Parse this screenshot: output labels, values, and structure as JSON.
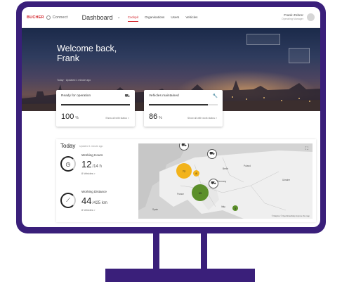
{
  "app": {
    "brand": "BUCHER",
    "brand_sub": "Connect",
    "dashboard_title": "Dashboard"
  },
  "nav": {
    "tabs": [
      "Cockpit",
      "Organisations",
      "Users",
      "Vehicles"
    ],
    "active_tab": 0
  },
  "user": {
    "name": "Frank Zohrer",
    "role": "Operating Manager"
  },
  "hero": {
    "welcome_line1": "Welcome back,",
    "welcome_line2": "Frank",
    "updated": "Today · Updated 1 minute ago"
  },
  "cards": [
    {
      "title": "Ready for operation",
      "icon": "truck-icon",
      "value": "100",
      "unit": "%",
      "progress": 1.0,
      "link": "Show all with status >"
    },
    {
      "title": "Vehicles maintained",
      "icon": "wrench-icon",
      "value": "86",
      "unit": "%",
      "progress": 0.86,
      "link": "Show all with work status >"
    }
  ],
  "today": {
    "title": "Today",
    "updated": "Updated 1 minute ago",
    "metrics": [
      {
        "label": "Working Hours",
        "value": "12",
        "of": "/14 h",
        "vehicles": "8 Vehicles >",
        "icon": "clock-icon"
      },
      {
        "label": "Working Distance",
        "value": "44",
        "of": "/425 km",
        "vehicles": "8 Vehicles >",
        "icon": "road-icon"
      }
    ]
  },
  "map": {
    "labels": [
      "Berlin",
      "Poland",
      "Ukraine",
      "Germany",
      "France",
      "Spain",
      "Italy"
    ],
    "bubbles": [
      {
        "label": "72",
        "color": "#f2b31b"
      },
      {
        "label": "8",
        "color": "#f2b31b"
      },
      {
        "label": "65",
        "color": "#5b8f2a"
      },
      {
        "label": "3",
        "color": "#5b8f2a"
      }
    ],
    "attribution": "© Mapbox © OpenStreetMap  Improve this map"
  },
  "colors": {
    "frame": "#3a1f7a",
    "accent": "#d2232a"
  }
}
